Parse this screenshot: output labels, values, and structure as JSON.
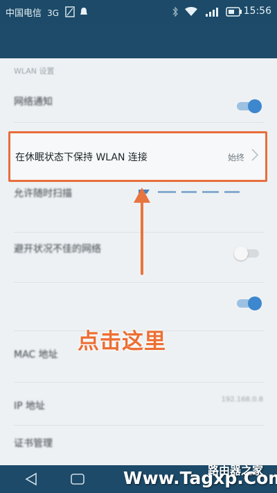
{
  "status_bar": {
    "carrier": "中国电信",
    "network": "3G",
    "time": "15:56",
    "icons": [
      "sim-icon",
      "notification-icon",
      "bluetooth-icon",
      "wifi-icon",
      "signal-icon",
      "battery-icon"
    ]
  },
  "settings": {
    "section_label": "WLAN 设置",
    "network_notify": {
      "title": "网络通知",
      "toggle": "on"
    },
    "keep_wlan": {
      "title": "在休眠状态下保持 WLAN 连接",
      "value": "始终"
    },
    "scan": {
      "title": "允许随时扫描"
    },
    "avoid_poor": {
      "title": "避开状况不佳的网络",
      "toggle": "off"
    },
    "wps": {
      "toggle": "on"
    },
    "mac": {
      "label": "MAC 地址"
    },
    "ip": {
      "label": "IP 地址",
      "value": "192.168.0.8"
    },
    "certs": {
      "label": "证书管理"
    }
  },
  "annotation": {
    "callout": "点击这里",
    "accent_color": "#e76e3c"
  },
  "watermark": {
    "site": "Www.Tagxp.Com",
    "name": "路由器之家"
  },
  "navbar": {
    "icons": [
      "back-icon",
      "home-icon",
      "recent-apps-icon"
    ]
  }
}
